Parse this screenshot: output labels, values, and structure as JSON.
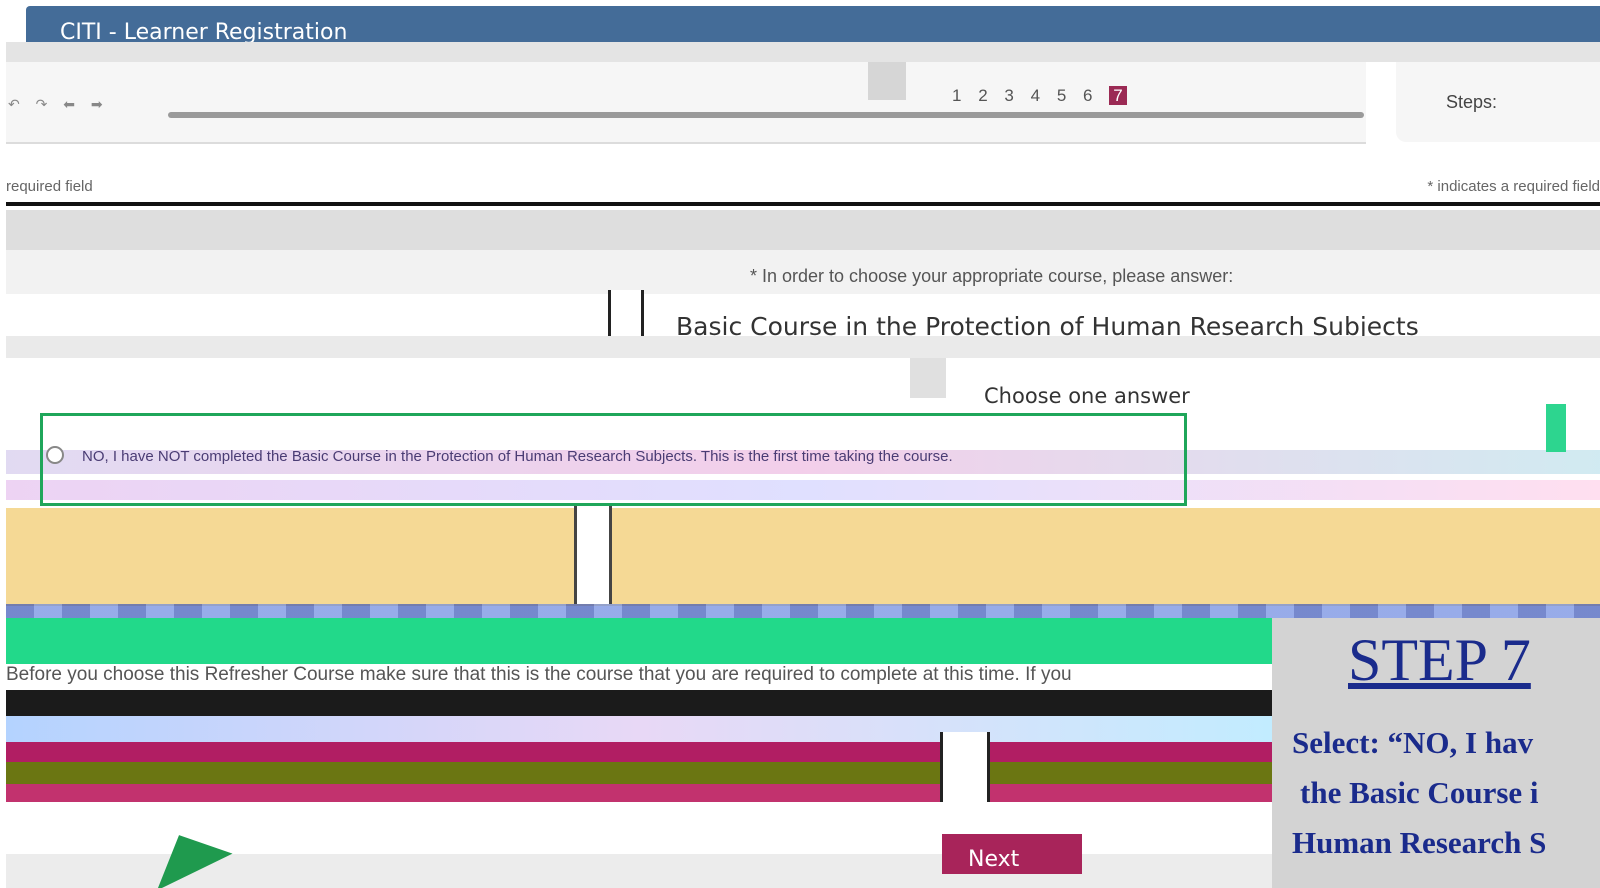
{
  "window": {
    "title": "CITI - Learner Registration"
  },
  "nav": {
    "tools": "↶ ↷ ⬅ ➡",
    "steps_label": "Steps:",
    "steps": [
      "1",
      "2",
      "3",
      "4",
      "5",
      "6",
      "7"
    ],
    "active_step": "7"
  },
  "form": {
    "required_note_left": "required field",
    "required_note_right": "* indicates a required field",
    "question": "* In order to choose your appropriate course, please answer:",
    "course_title": "Basic Course in the Protection of Human Research Subjects",
    "choose_label": "Choose one answer",
    "option_no": "NO, I have NOT completed the Basic Course in the Protection of Human Research Subjects. This is the first time taking the course.",
    "refresher_text": "Before you choose this Refresher Course make sure that this is the course that you are required to complete at this time. If you"
  },
  "buttons": {
    "next_label": "Next"
  },
  "instruction": {
    "step_title": "STEP 7",
    "line1": "Select: “NO, I hav",
    "line2": "the Basic Course i",
    "line3": "Human Research S"
  },
  "colors": {
    "titlebar": "#446c98",
    "highlight_box": "#1fa65a",
    "next_button": "#a8245a",
    "step_text": "#1a2b8c"
  }
}
